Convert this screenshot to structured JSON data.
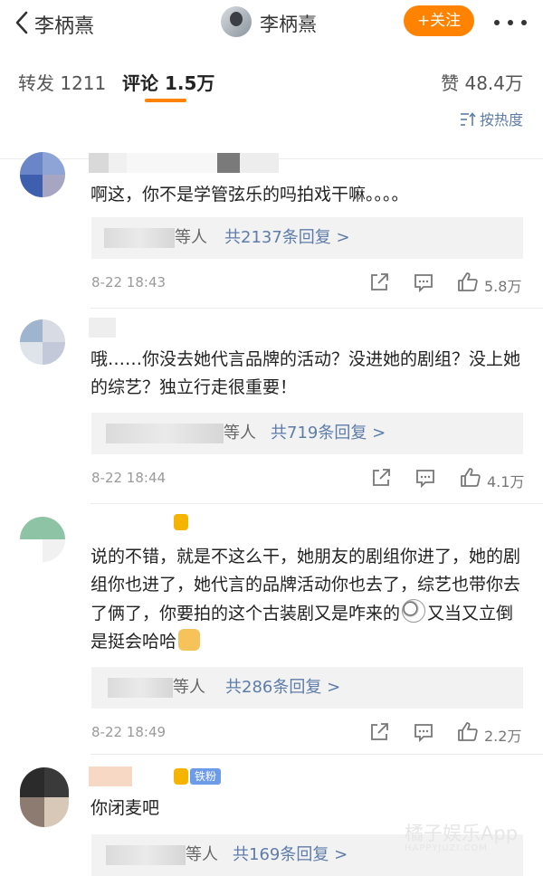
{
  "header": {
    "back_label": "李柄熹",
    "title": "李柄熹",
    "follow_label": "+关注"
  },
  "tabs": {
    "reposts": "转发 1211",
    "comments": "评论 1.5万",
    "likes": "赞 48.4万"
  },
  "sort": {
    "label": "按热度"
  },
  "comments": [
    {
      "text": "啊这，你不是学管弦乐的吗拍戏干嘛。。。。",
      "reply_suffix": "等人",
      "reply_link": "共2137条回复 >",
      "time": "8-22 18:43",
      "likes": "5.8万"
    },
    {
      "text": "哦……你没去她代言品牌的活动？没进她的剧组？没上她的综艺？独立行走很重要！",
      "reply_suffix": "等人",
      "reply_link": "共719条回复 >",
      "time": "8-22 18:44",
      "likes": "4.1万"
    },
    {
      "text_a": "说的不错，就是不这么干，她朋友的剧组你进了，她的剧组你也进了，她代言的品牌活动你也去了，综艺也带你去了俩了，你要拍的这个古装剧又是咋来的",
      "text_b": "又当又立倒是挺会哈哈",
      "reply_suffix": "等人",
      "reply_link": "共286条回复 >",
      "time": "8-22 18:49",
      "likes": "2.2万"
    },
    {
      "badge": "铁粉",
      "text": "你闭麦吧",
      "reply_suffix": "等人",
      "reply_link": "共169条回复 >"
    }
  ],
  "watermark": {
    "main": "橘子娱乐App",
    "sub": "HAPPYJUZI.COM"
  }
}
